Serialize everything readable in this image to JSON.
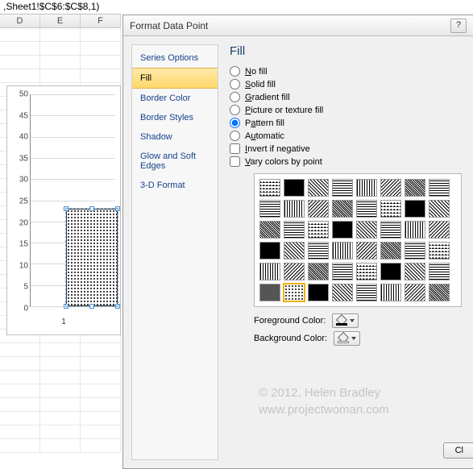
{
  "formula": ",Sheet1!$C$6:$C$8,1)",
  "columns": [
    "D",
    "E",
    "F"
  ],
  "chart_data": {
    "type": "bar",
    "categories": [
      "1"
    ],
    "values": [
      23
    ],
    "title": "",
    "xlabel": "",
    "ylabel": "",
    "ylim": [
      0,
      50
    ],
    "yticks": [
      0,
      5,
      10,
      15,
      20,
      25,
      30,
      35,
      40,
      45,
      50
    ]
  },
  "dialog": {
    "title": "Format Data Point",
    "help": "?",
    "close": "Cl"
  },
  "sidebar": {
    "items": [
      {
        "label": "Series Options"
      },
      {
        "label": "Fill",
        "selected": true
      },
      {
        "label": "Border Color"
      },
      {
        "label": "Border Styles"
      },
      {
        "label": "Shadow"
      },
      {
        "label": "Glow and Soft Edges"
      },
      {
        "label": "3-D Format"
      }
    ]
  },
  "fill": {
    "heading": "Fill",
    "options": {
      "no_fill": "No fill",
      "solid_fill": "Solid fill",
      "gradient_fill": "Gradient fill",
      "picture_fill": "Picture or texture fill",
      "pattern_fill": "Pattern fill",
      "automatic": "Automatic"
    },
    "selected": "pattern_fill",
    "invert_label": "Invert if negative",
    "vary_label": "Vary colors by point",
    "foreground_label": "Foreground Color:",
    "background_label": "Background Color:"
  },
  "watermark": {
    "line1": "© 2012, Helen Bradley",
    "line2": "www.projectwoman.com"
  }
}
